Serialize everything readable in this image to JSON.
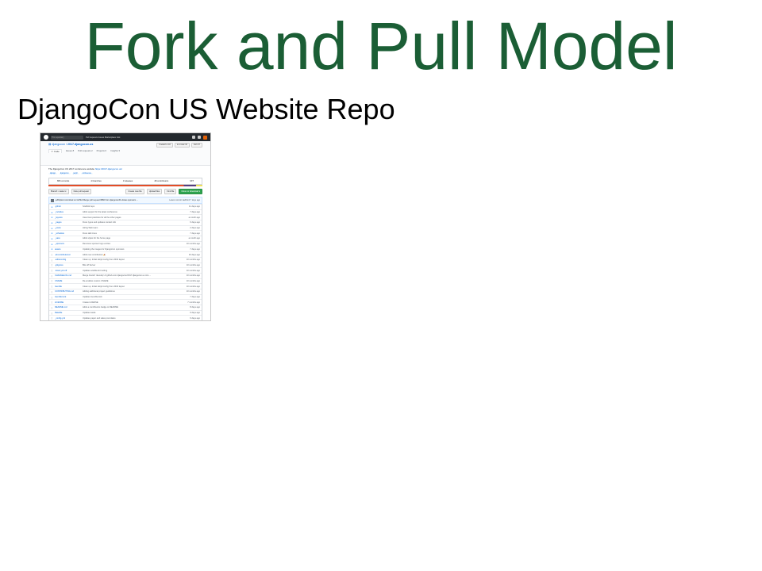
{
  "slide": {
    "title": "Fork and Pull Model",
    "subtitle": "DjangoCon US Website Repo"
  },
  "screenshot": {
    "header": {
      "search_placeholder": "This repository",
      "search_hint": "Search",
      "nav": "Pull requests   Issues   Marketplace   Gist"
    },
    "repo": {
      "owner": "djangocon",
      "name": "2017.djangocon.us",
      "buttons": [
        "Unwatch ▾  18",
        "★ Unstar  32",
        "Fork  67"
      ],
      "tabs": [
        "<> Code",
        "Issues  8",
        "Pull requests  2",
        "Projects  0",
        "Insights ▾"
      ]
    },
    "about": {
      "description": "The DjangoCon US 2017 conference website",
      "link": "https://2017.djangocon.us/",
      "topics": [
        "django",
        "djangocon",
        "jekyll",
        "conference"
      ]
    },
    "stats": [
      "866 commits",
      "4 branches",
      "0 releases",
      "48 contributors",
      "MIT"
    ],
    "actions": {
      "branch": "Branch: master ▾",
      "new_pr": "New pull request",
      "create_file": "Create new file",
      "upload": "Upload files",
      "find": "Find file",
      "clone": "Clone or download ▾"
    },
    "latest_commit": {
      "message": "jefftriplett committed on GitHub Merge pull request #882 from djangocon/fix-footer-sponsors ...",
      "meta": "Latest commit 1a2b3c4 7 days ago"
    },
    "files": [
      {
        "type": "dir",
        "name": ".github",
        "message": "Scaffold repo",
        "age": "11 days ago"
      },
      {
        "type": "dir",
        "name": "_includes",
        "message": "Adds support for the latest conference",
        "age": "7 days ago"
      },
      {
        "type": "dir",
        "name": "_layouts",
        "message": "Uses best practices for all the other pages",
        "age": "a month ago"
      },
      {
        "type": "dir",
        "name": "_pages",
        "message": "Fixes typos and updates contact info",
        "age": "6 days ago"
      },
      {
        "type": "dir",
        "name": "_posts",
        "message": "Hiring Web team",
        "age": "2 days ago"
      },
      {
        "type": "dir",
        "name": "_schedule",
        "message": "Fixes talk times",
        "age": "7 days ago"
      },
      {
        "type": "dir",
        "name": "_sass",
        "message": "Adds styles for the home page",
        "age": "a month ago"
      },
      {
        "type": "dir",
        "name": "_sponsors",
        "message": "Removes sponsor logo entries",
        "age": "10 months ago"
      },
      {
        "type": "dir",
        "name": "assets",
        "message": "Updating the images for DjangoCon sponsors",
        "age": "7 days ago"
      },
      {
        "type": "file",
        "name": ".all-contributorsrc",
        "message": "Adds new contributors 🎉",
        "age": "16 days ago"
      },
      {
        "type": "file",
        "name": ".editorconfig",
        "message": "Clean up. Initial Jekyll config from 2016 layout",
        "age": "10 months ago"
      },
      {
        "type": "file",
        "name": ".gitignore",
        "message": "Bits off Server",
        "age": "10 months ago"
      },
      {
        "type": "file",
        "name": ".travis.yml.off",
        "message": "Updates ansible-lint tooling",
        "age": "10 months ago"
      },
      {
        "type": "file",
        "name": "CHANGELOG.md",
        "message": "Merge branch 'develop' of github.com:djangocon/2017.djangocon.us into ...",
        "age": "10 months ago"
      },
      {
        "type": "file",
        "name": "CNAME",
        "message": "Re-enables custom CNAME",
        "age": "10 months ago"
      },
      {
        "type": "file",
        "name": "Gemfile",
        "message": "Clean up. Initial Jekyll config from 2016 layout",
        "age": "10 months ago"
      },
      {
        "type": "file",
        "name": "CONTRIBUTING.md",
        "message": "Adding additional project guidelines",
        "age": "10 months ago"
      },
      {
        "type": "file",
        "name": "Gemfile.lock",
        "message": "Updates Gemfile lock",
        "age": "7 days ago"
      },
      {
        "type": "file",
        "name": "LICENSE",
        "message": "Create LICENSE",
        "age": "7 months ago"
      },
      {
        "type": "file",
        "name": "README.md",
        "message": "Adds a contributors badge to README",
        "age": "8 days ago"
      },
      {
        "type": "file",
        "name": "Rakefile",
        "message": "Updates tasks",
        "age": "9 days ago"
      },
      {
        "type": "file",
        "name": "_config.yml",
        "message": "Updates paper and sales post dates",
        "age": "6 days ago"
      },
      {
        "type": "file",
        "name": "conduct.md",
        "message": "Bits off Server",
        "age": "10 months ago"
      },
      {
        "type": "file",
        "name": "package.json",
        "message": "Adds new contributors 🎉",
        "age": "16 days ago"
      }
    ]
  }
}
